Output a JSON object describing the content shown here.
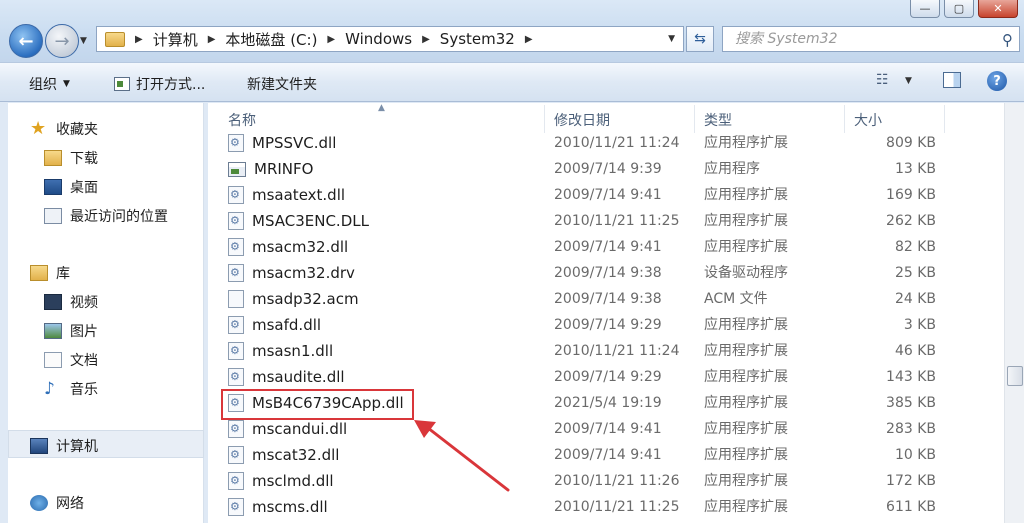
{
  "window": {
    "buttons": [
      "—",
      "▢",
      "✕"
    ]
  },
  "address": {
    "crumbs": [
      "计算机",
      "本地磁盘 (C:)",
      "Windows",
      "System32"
    ]
  },
  "search": {
    "placeholder": "搜索 System32"
  },
  "toolbar": {
    "organize": "组织",
    "open_with": "打开方式...",
    "new_folder": "新建文件夹"
  },
  "nav": {
    "favorites": {
      "label": "收藏夹",
      "items": [
        "下载",
        "桌面",
        "最近访问的位置"
      ]
    },
    "libraries": {
      "label": "库",
      "items": [
        "视频",
        "图片",
        "文档",
        "音乐"
      ]
    },
    "computer": "计算机",
    "network": "网络"
  },
  "columns": {
    "name": "名称",
    "date": "修改日期",
    "type": "类型",
    "size": "大小"
  },
  "files": [
    {
      "name": "MPSSVC.dll",
      "date": "2010/11/21 11:24",
      "type": "应用程序扩展",
      "size": "809 KB",
      "icon": "dll"
    },
    {
      "name": "MRINFO",
      "date": "2009/7/14 9:39",
      "type": "应用程序",
      "size": "13 KB",
      "icon": "exe"
    },
    {
      "name": "msaatext.dll",
      "date": "2009/7/14 9:41",
      "type": "应用程序扩展",
      "size": "169 KB",
      "icon": "dll"
    },
    {
      "name": "MSAC3ENC.DLL",
      "date": "2010/11/21 11:25",
      "type": "应用程序扩展",
      "size": "262 KB",
      "icon": "dll"
    },
    {
      "name": "msacm32.dll",
      "date": "2009/7/14 9:41",
      "type": "应用程序扩展",
      "size": "82 KB",
      "icon": "dll"
    },
    {
      "name": "msacm32.drv",
      "date": "2009/7/14 9:38",
      "type": "设备驱动程序",
      "size": "25 KB",
      "icon": "dll"
    },
    {
      "name": "msadp32.acm",
      "date": "2009/7/14 9:38",
      "type": "ACM 文件",
      "size": "24 KB",
      "icon": "doc"
    },
    {
      "name": "msafd.dll",
      "date": "2009/7/14 9:29",
      "type": "应用程序扩展",
      "size": "3 KB",
      "icon": "dll"
    },
    {
      "name": "msasn1.dll",
      "date": "2010/11/21 11:24",
      "type": "应用程序扩展",
      "size": "46 KB",
      "icon": "dll"
    },
    {
      "name": "msaudite.dll",
      "date": "2009/7/14 9:29",
      "type": "应用程序扩展",
      "size": "143 KB",
      "icon": "dll"
    },
    {
      "name": "MsB4C6739CApp.dll",
      "date": "2021/5/4 19:19",
      "type": "应用程序扩展",
      "size": "385 KB",
      "icon": "dll"
    },
    {
      "name": "mscandui.dll",
      "date": "2009/7/14 9:41",
      "type": "应用程序扩展",
      "size": "283 KB",
      "icon": "dll"
    },
    {
      "name": "mscat32.dll",
      "date": "2009/7/14 9:41",
      "type": "应用程序扩展",
      "size": "10 KB",
      "icon": "dll"
    },
    {
      "name": "msclmd.dll",
      "date": "2010/11/21 11:26",
      "type": "应用程序扩展",
      "size": "172 KB",
      "icon": "dll"
    },
    {
      "name": "mscms.dll",
      "date": "2010/11/21 11:25",
      "type": "应用程序扩展",
      "size": "611 KB",
      "icon": "dll"
    }
  ],
  "annotation": {
    "highlight_color": "#d9363a"
  }
}
